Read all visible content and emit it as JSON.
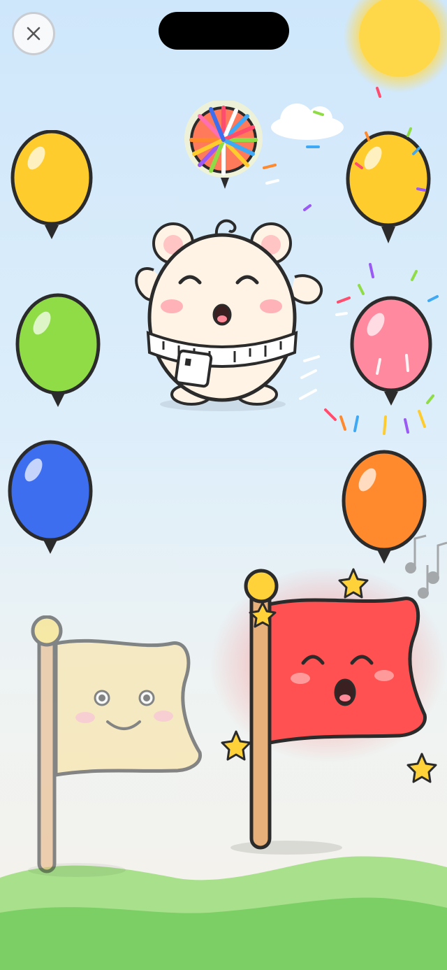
{
  "screen": {
    "close_label": "×"
  },
  "colors": {
    "sky_top": "#cfe7fb",
    "grass_light": "#a8e08c",
    "grass_dark": "#7bcf65",
    "outline": "#2b2b2b",
    "sun": "#ffd84a"
  },
  "balloons": [
    {
      "id": "yellow-left",
      "color": "#ffcc2e",
      "state": "intact"
    },
    {
      "id": "popped",
      "color": "#ff7a5a",
      "state": "popping"
    },
    {
      "id": "yellow-right",
      "color": "#ffcc2e",
      "state": "intact"
    },
    {
      "id": "green",
      "color": "#8fdc47",
      "state": "intact"
    },
    {
      "id": "pink",
      "color": "#ff8aa0",
      "state": "intact"
    },
    {
      "id": "blue",
      "color": "#3e6ef0",
      "state": "intact"
    },
    {
      "id": "orange",
      "color": "#ff8a2e",
      "state": "intact"
    }
  ],
  "mascot": {
    "icon": "hamster-mascot-icon",
    "expression": "singing"
  },
  "flags": [
    {
      "id": "yellow-flag",
      "color": "#fbe29a",
      "expression": "smiling",
      "state": "faded"
    },
    {
      "id": "red-flag",
      "color": "#ff5151",
      "expression": "singing",
      "state": "highlighted"
    }
  ]
}
